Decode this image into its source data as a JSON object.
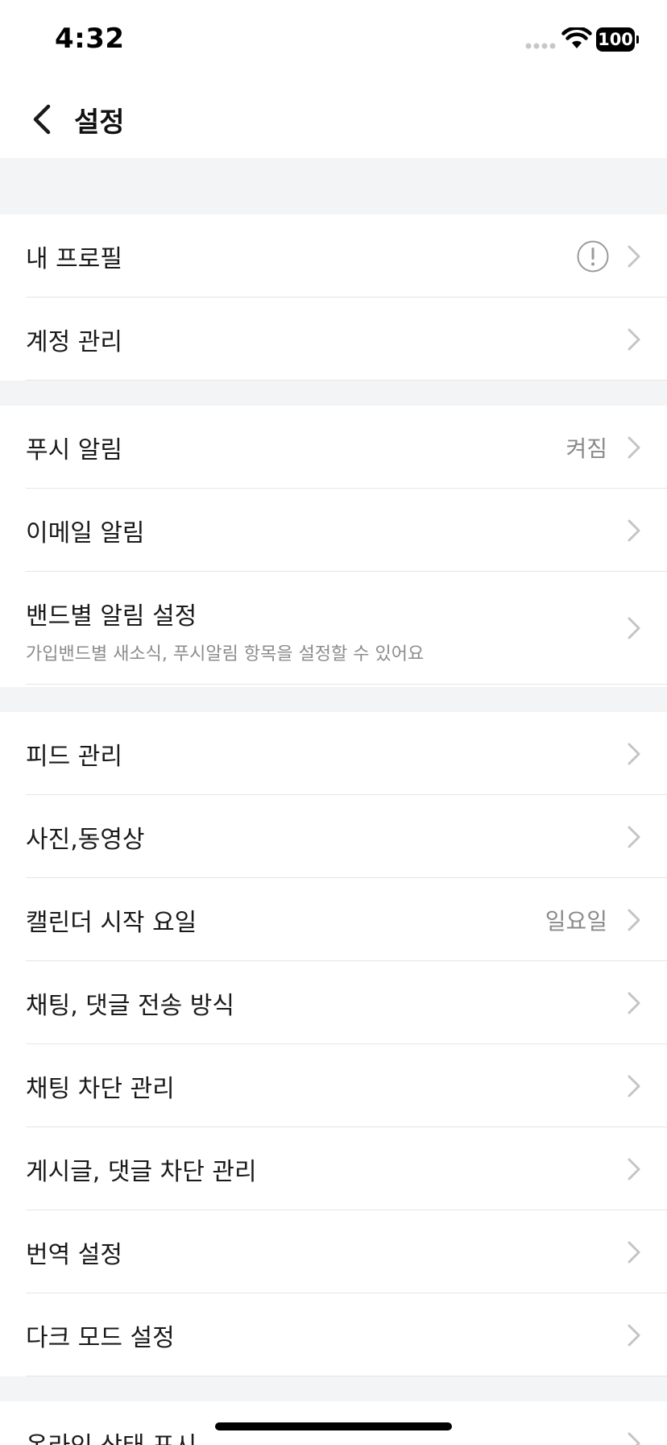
{
  "status_bar": {
    "time": "4:32",
    "battery": "100"
  },
  "nav": {
    "title": "설정"
  },
  "sections": [
    {
      "items": [
        {
          "label": "내 프로필",
          "has_alert": true
        },
        {
          "label": "계정 관리"
        }
      ]
    },
    {
      "items": [
        {
          "label": "푸시 알림",
          "value": "켜짐"
        },
        {
          "label": "이메일 알림"
        },
        {
          "label": "밴드별 알림 설정",
          "subtitle": "가입밴드별 새소식, 푸시알림 항목을 설정할 수 있어요"
        }
      ]
    },
    {
      "items": [
        {
          "label": "피드 관리"
        },
        {
          "label": "사진,동영상"
        },
        {
          "label": "캘린더 시작 요일",
          "value": "일요일"
        },
        {
          "label": "채팅, 댓글 전송 방식"
        },
        {
          "label": "채팅 차단 관리"
        },
        {
          "label": "게시글, 댓글 차단 관리"
        },
        {
          "label": "번역 설정"
        },
        {
          "label": "다크 모드 설정"
        }
      ]
    },
    {
      "items": [
        {
          "label": "온라인 상태 표시"
        }
      ]
    }
  ]
}
